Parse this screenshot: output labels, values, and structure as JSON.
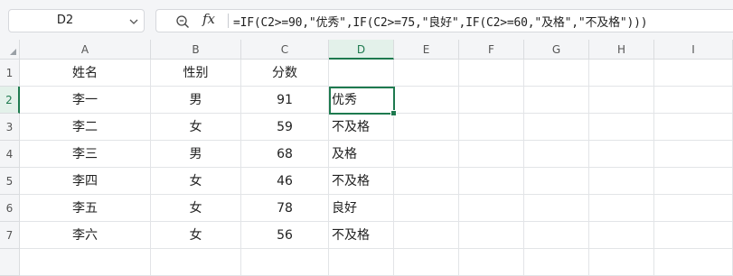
{
  "name_box": {
    "value": "D2"
  },
  "formula_bar": {
    "fx_label": "fx",
    "formula": "=IF(C2>=90,\"优秀\",IF(C2>=75,\"良好\",IF(C2>=60,\"及格\",\"不及格\")))"
  },
  "columns": [
    "A",
    "B",
    "C",
    "D",
    "E",
    "F",
    "G",
    "H",
    "I"
  ],
  "active_column": "D",
  "active_row": 2,
  "rows": [
    {
      "num": "1",
      "cells": [
        "姓名",
        "性别",
        "分数",
        "",
        "",
        "",
        "",
        "",
        ""
      ]
    },
    {
      "num": "2",
      "cells": [
        "李一",
        "男",
        "91",
        "优秀",
        "",
        "",
        "",
        "",
        ""
      ]
    },
    {
      "num": "3",
      "cells": [
        "李二",
        "女",
        "59",
        "不及格",
        "",
        "",
        "",
        "",
        ""
      ]
    },
    {
      "num": "4",
      "cells": [
        "李三",
        "男",
        "68",
        "及格",
        "",
        "",
        "",
        "",
        ""
      ]
    },
    {
      "num": "5",
      "cells": [
        "李四",
        "女",
        "46",
        "不及格",
        "",
        "",
        "",
        "",
        ""
      ]
    },
    {
      "num": "6",
      "cells": [
        "李五",
        "女",
        "78",
        "良好",
        "",
        "",
        "",
        "",
        ""
      ]
    },
    {
      "num": "7",
      "cells": [
        "李六",
        "女",
        "56",
        "不及格",
        "",
        "",
        "",
        "",
        ""
      ]
    },
    {
      "num": "",
      "cells": [
        "",
        "",
        "",
        "",
        "",
        "",
        "",
        "",
        ""
      ]
    }
  ],
  "colors": {
    "accent": "#1e7a4f",
    "header_bg": "#f4f5f7",
    "grid": "#e2e4e7"
  }
}
